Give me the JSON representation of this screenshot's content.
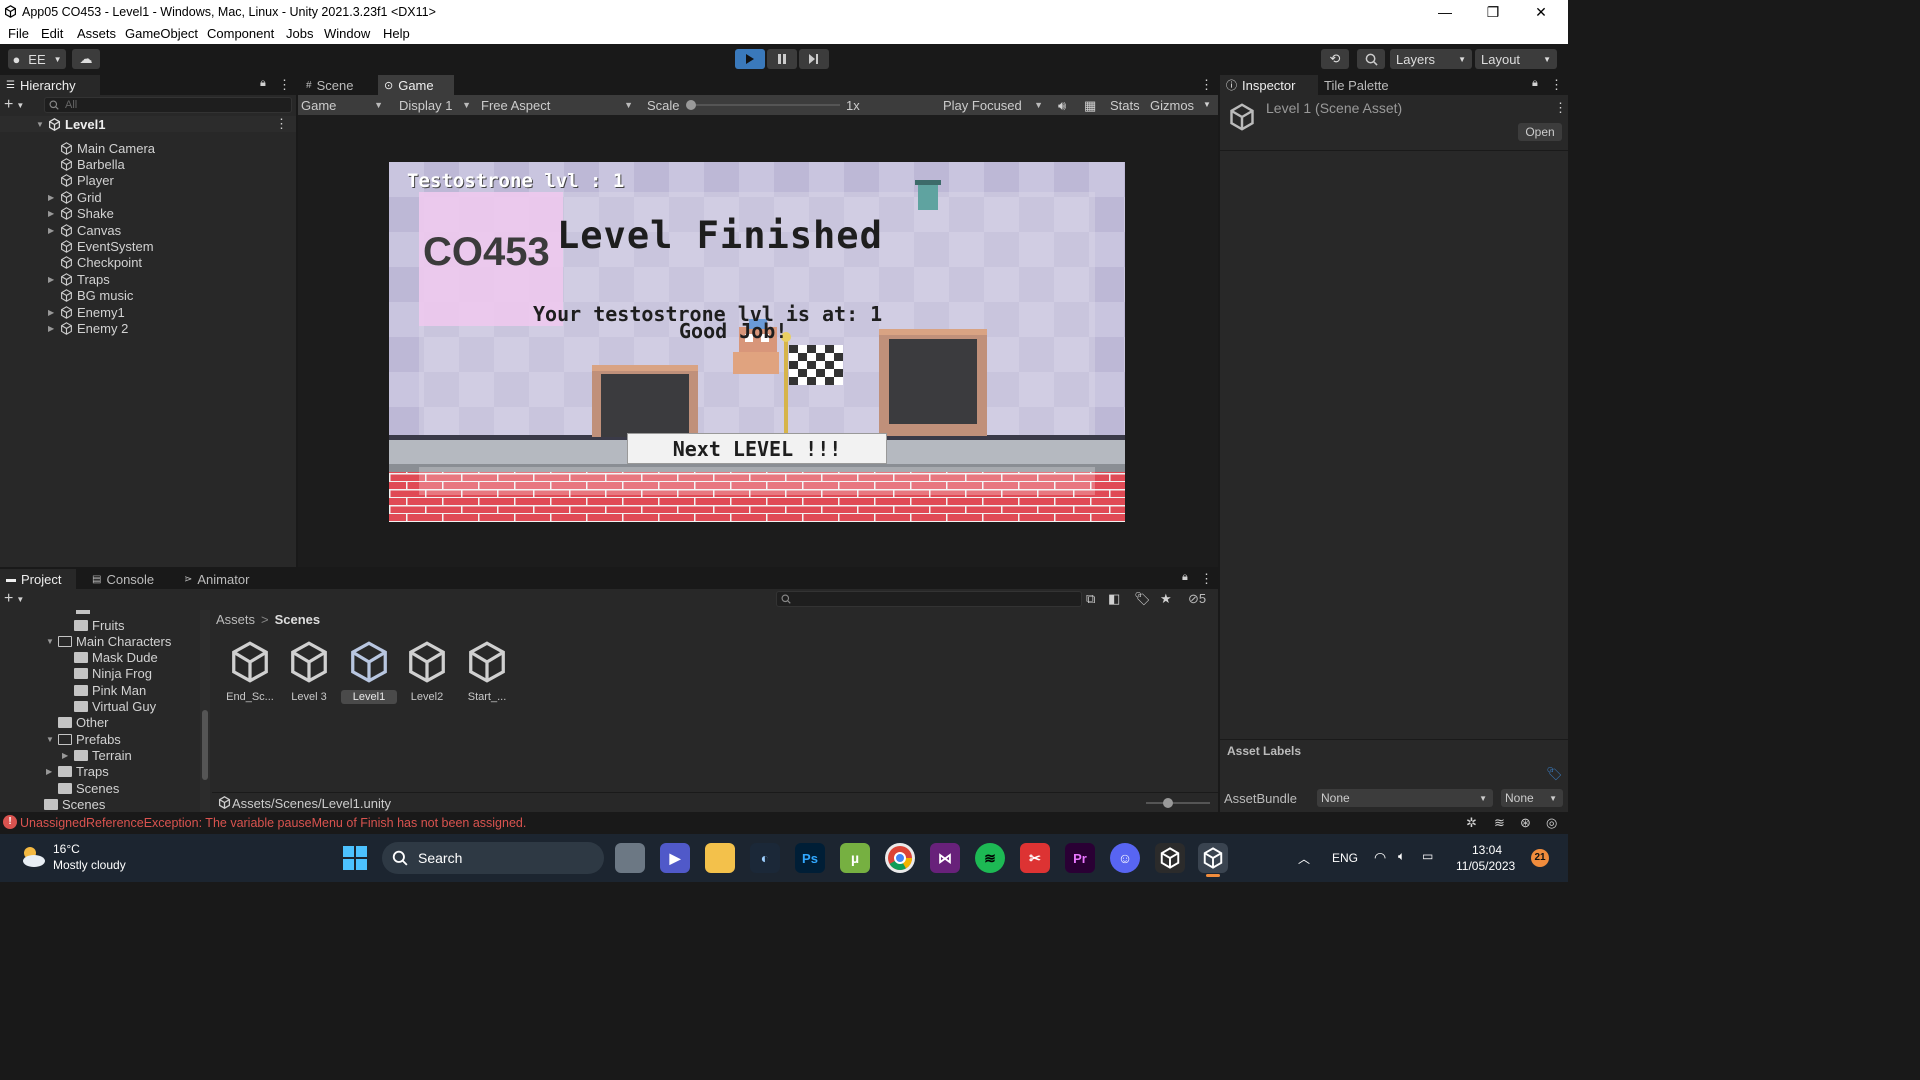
{
  "window": {
    "title": "App05 CO453 - Level1 - Windows, Mac, Linux - Unity 2021.3.23f1 <DX11>",
    "controls": [
      "—",
      "❐",
      "✕"
    ]
  },
  "menu": [
    "File",
    "Edit",
    "Assets",
    "GameObject",
    "Component",
    "Jobs",
    "Window",
    "Help"
  ],
  "toolbar": {
    "account": "EE",
    "layers": "Layers",
    "layout": "Layout"
  },
  "hierarchy": {
    "tab": "Hierarchy",
    "search_placeholder": "All",
    "scene": "Level1",
    "items": [
      {
        "label": "Main Camera",
        "expandable": false
      },
      {
        "label": "Barbella",
        "expandable": false
      },
      {
        "label": "Player",
        "expandable": false
      },
      {
        "label": "Grid",
        "expandable": true
      },
      {
        "label": "Shake",
        "expandable": true
      },
      {
        "label": "Canvas",
        "expandable": true
      },
      {
        "label": "EventSystem",
        "expandable": false
      },
      {
        "label": "Checkpoint",
        "expandable": false
      },
      {
        "label": "Traps",
        "expandable": true
      },
      {
        "label": "BG music",
        "expandable": false
      },
      {
        "label": "Enemy1",
        "expandable": true
      },
      {
        "label": "Enemy 2",
        "expandable": true
      }
    ]
  },
  "view_tabs": {
    "scene": "Scene",
    "game": "Game"
  },
  "game_bar": {
    "mode": "Game",
    "display": "Display 1",
    "aspect": "Free Aspect",
    "scale_label": "Scale",
    "scale_value": "1x",
    "play_focused": "Play Focused",
    "stats": "Stats",
    "gizmos": "Gizmos"
  },
  "game": {
    "hud": "Testostrone lvl : 1",
    "watermark": "CO453",
    "heading": "Level Finished",
    "message": "Your testostrone lvl is at: 1",
    "sub_message": "Good Job!",
    "next_button": "Next LEVEL !!!"
  },
  "inspector": {
    "tab": "Inspector",
    "tab2": "Tile Palette",
    "asset": "Level 1 (Scene Asset)",
    "open": "Open",
    "asset_labels": "Asset Labels",
    "assetbundle_label": "AssetBundle",
    "assetbundle_value": "None",
    "variant_value": "None"
  },
  "bottom_tabs": {
    "project": "Project",
    "console": "Console",
    "animator": "Animator"
  },
  "project_tree": [
    {
      "label": "Fruits",
      "indent": 2,
      "arrow": "",
      "open": false
    },
    {
      "label": "Main Characters",
      "indent": 1,
      "arrow": "▼",
      "open": true
    },
    {
      "label": "Mask Dude",
      "indent": 2,
      "arrow": "",
      "open": false
    },
    {
      "label": "Ninja Frog",
      "indent": 2,
      "arrow": "",
      "open": false
    },
    {
      "label": "Pink Man",
      "indent": 2,
      "arrow": "",
      "open": false
    },
    {
      "label": "Virtual Guy",
      "indent": 2,
      "arrow": "",
      "open": false
    },
    {
      "label": "Other",
      "indent": 1,
      "arrow": "",
      "open": false
    },
    {
      "label": "Prefabs",
      "indent": 1,
      "arrow": "▼",
      "open": true
    },
    {
      "label": "Terrain",
      "indent": 2,
      "arrow": "▶",
      "open": false
    },
    {
      "label": "Traps",
      "indent": 1,
      "arrow": "▶",
      "open": false
    },
    {
      "label": "Scenes",
      "indent": 1,
      "arrow": "",
      "open": false
    },
    {
      "label": "Scenes",
      "indent": 0,
      "arrow": "",
      "open": false
    }
  ],
  "breadcrumb": {
    "root": "Assets",
    "separator": ">",
    "current": "Scenes"
  },
  "assets": [
    "End_Sc...",
    "Level 3",
    "Level1",
    "Level2",
    "Start_..."
  ],
  "hidden_count": "5",
  "asset_path": "Assets/Scenes/Level1.unity",
  "console_error": "UnassignedReferenceException: The variable pauseMenu of Finish has not been assigned.",
  "taskbar": {
    "weather_temp": "16°C",
    "weather_desc": "Mostly cloudy",
    "search": "Search",
    "language": "ENG",
    "time": "13:04",
    "date": "11/05/2023",
    "notification_count": "21"
  },
  "colors": {
    "accent": "#3a79bb",
    "error": "#d9534f",
    "game_bg": "#b8b3d0",
    "brick": "#d94552"
  }
}
